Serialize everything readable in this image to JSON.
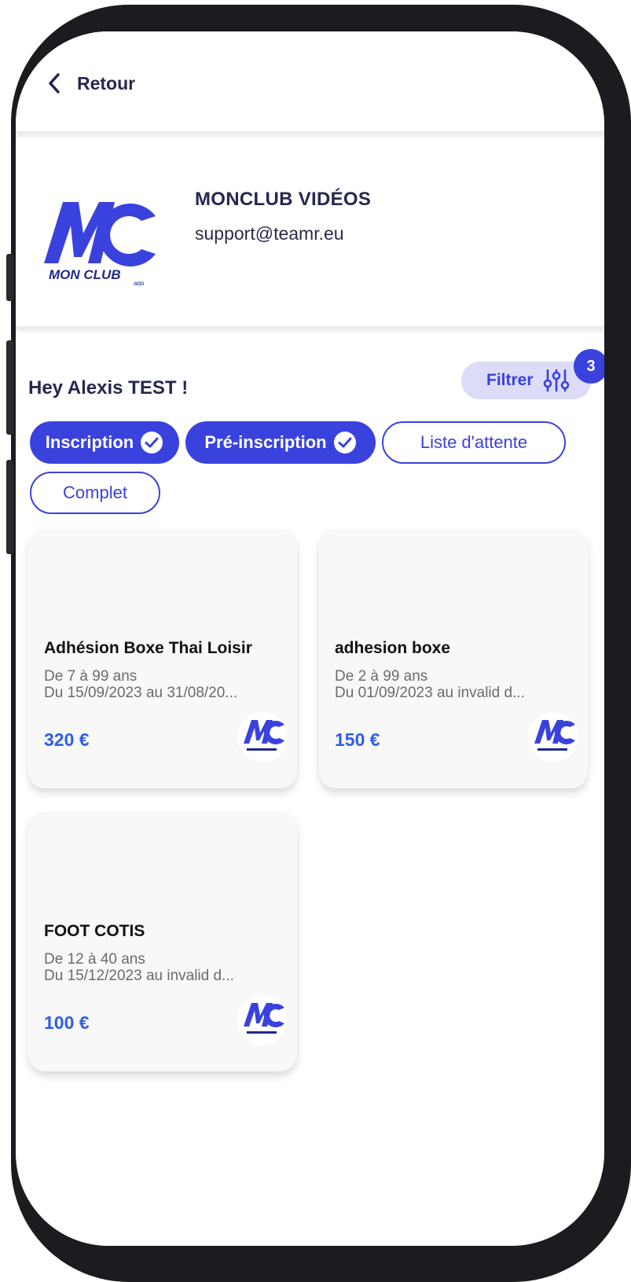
{
  "nav": {
    "back_label": "Retour"
  },
  "club": {
    "name": "MONCLUB VIDÉOS",
    "email": "support@teamr.eu",
    "logo_text": "MON CLUB",
    "logo_sub": "app"
  },
  "greeting": "Hey Alexis TEST !",
  "filter": {
    "label": "Filtrer",
    "badge_count": "3"
  },
  "chips": [
    {
      "label": "Inscription",
      "active": true
    },
    {
      "label": "Pré-inscription",
      "active": true
    },
    {
      "label": "Liste d'attente",
      "active": false
    },
    {
      "label": "Complet",
      "active": false
    }
  ],
  "cards": [
    {
      "title": "Adhésion Boxe Thai Loisir",
      "age": "De 7 à 99 ans",
      "dates": "Du 15/09/2023 au 31/08/20...",
      "price": "320 €"
    },
    {
      "title": "adhesion boxe",
      "age": "De 2 à 99 ans",
      "dates": "Du 01/09/2023 au invalid d...",
      "price": "150 €"
    },
    {
      "title": "FOOT COTIS",
      "age": "De 12 à 40 ans",
      "dates": "Du 15/12/2023 au invalid d...",
      "price": "100 €"
    }
  ],
  "colors": {
    "accent": "#3a42de",
    "price": "#2f5fe0",
    "text_dark": "#24284f"
  }
}
